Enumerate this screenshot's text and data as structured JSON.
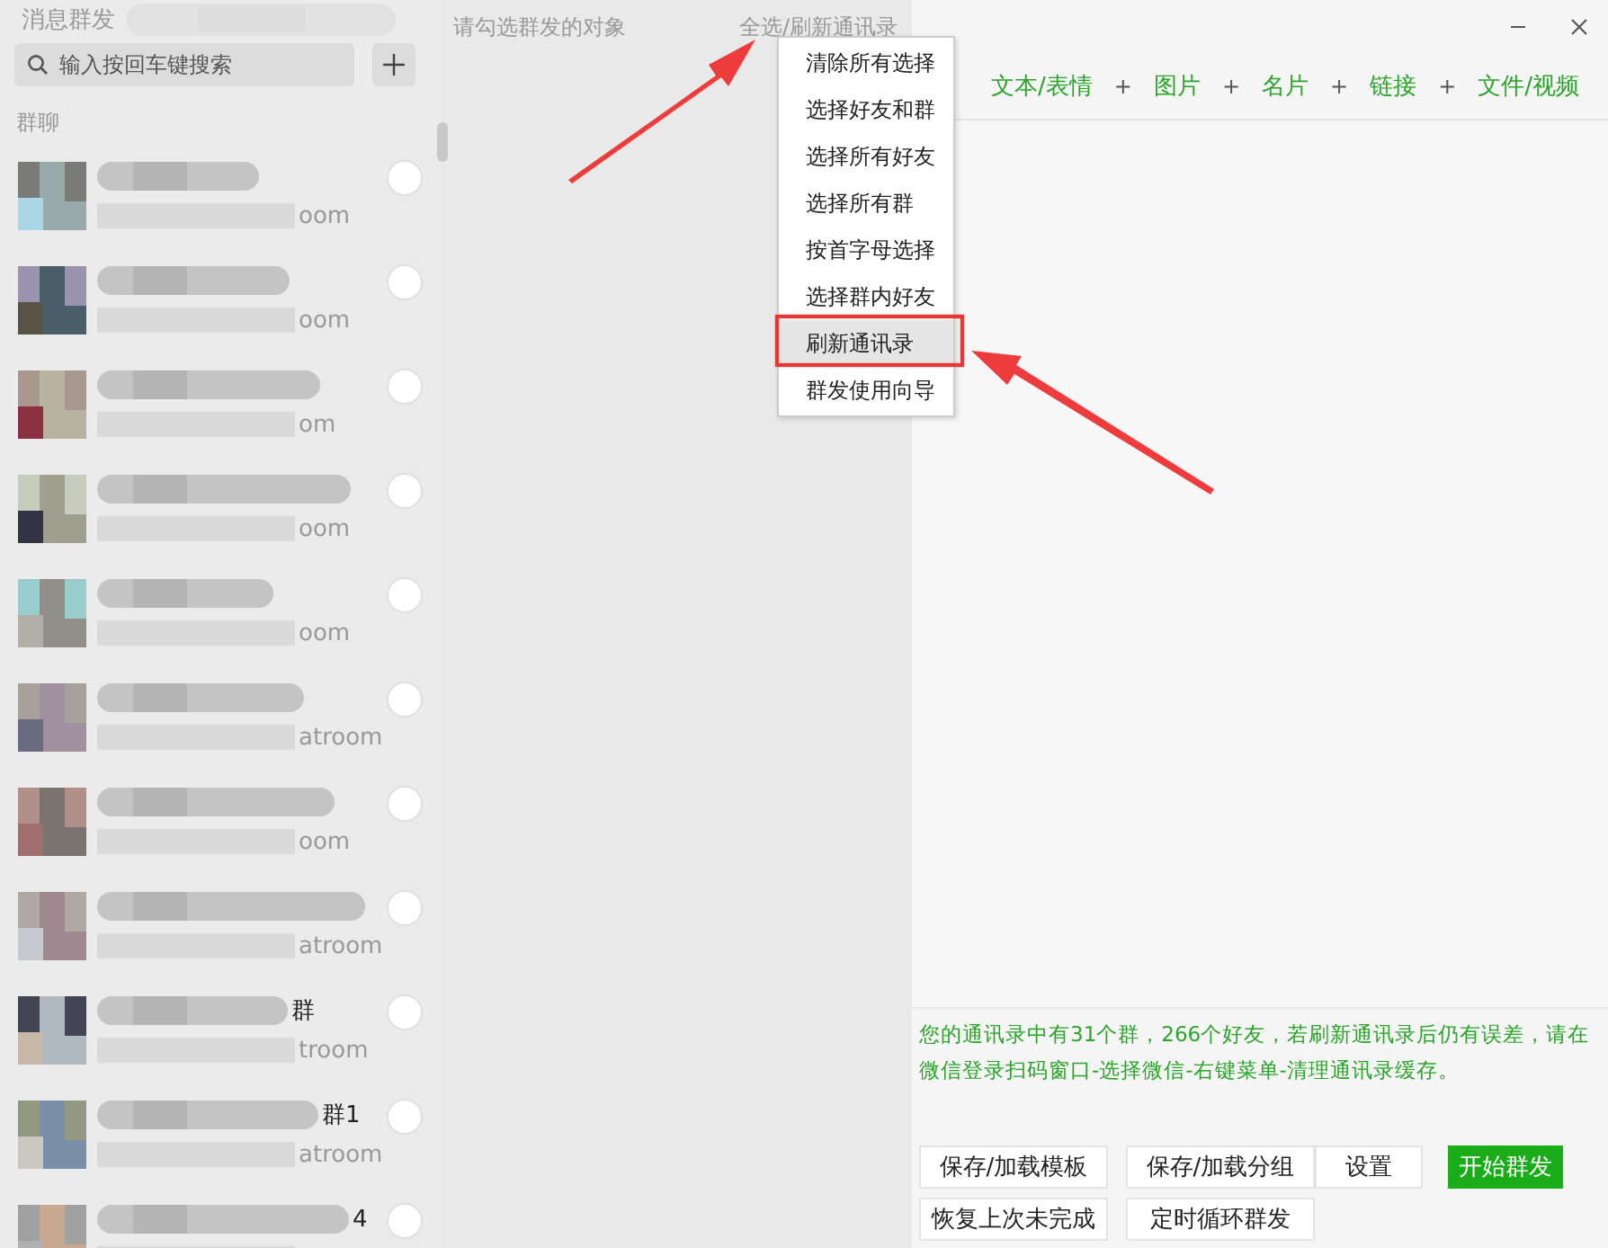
{
  "window": {
    "title": "消息群发"
  },
  "search": {
    "placeholder": "输入按回车键搜索"
  },
  "section_label": "群聊",
  "contacts": [
    {
      "id_tail": "oom",
      "selected": false
    },
    {
      "id_tail": "oom",
      "selected": false
    },
    {
      "id_tail": "om",
      "selected": false
    },
    {
      "id_tail": "oom",
      "selected": false
    },
    {
      "id_tail": "oom",
      "selected": false
    },
    {
      "id_tail": "atroom",
      "selected": false
    },
    {
      "id_tail": "oom",
      "selected": false
    },
    {
      "id_tail": "atroom",
      "selected": false
    },
    {
      "name_tail": "群",
      "id_tail": "troom",
      "selected": false
    },
    {
      "name_tail": "群1",
      "id_tail": "atroom",
      "selected": false
    },
    {
      "name_tail": "4",
      "selected": false
    }
  ],
  "middle": {
    "hint": "请勾选群发的对象",
    "select_link": "全选/刷新通讯录"
  },
  "menu": [
    {
      "label": "清除所有选择",
      "selected": false
    },
    {
      "label": "选择好友和群",
      "selected": false
    },
    {
      "label": "选择所有好友",
      "selected": false
    },
    {
      "label": "选择所有群",
      "selected": false
    },
    {
      "label": "按首字母选择",
      "selected": false
    },
    {
      "label": "选择群内好友",
      "selected": false
    },
    {
      "label": "刷新通讯录",
      "selected": true
    },
    {
      "label": "群发使用向导",
      "selected": false
    }
  ],
  "content_types": [
    "文本/表情",
    "图片",
    "名片",
    "链接",
    "文件/视频"
  ],
  "content_separator": "+",
  "status_text": "您的通讯录中有31个群，266个好友，若刷新通讯录后仍有误差，请在微信登录扫码窗口-选择微信-右键菜单-清理通讯录缓存。",
  "buttons": [
    {
      "label": "保存/加载模板",
      "kind": "plain"
    },
    {
      "label": "保存/加载分组",
      "kind": "plain"
    },
    {
      "label": "设置",
      "kind": "plain"
    },
    {
      "label": "开始群发",
      "kind": "primary"
    },
    {
      "label": "恢复上次未完成",
      "kind": "plain"
    },
    {
      "label": "定时循环群发",
      "kind": "plain"
    }
  ]
}
